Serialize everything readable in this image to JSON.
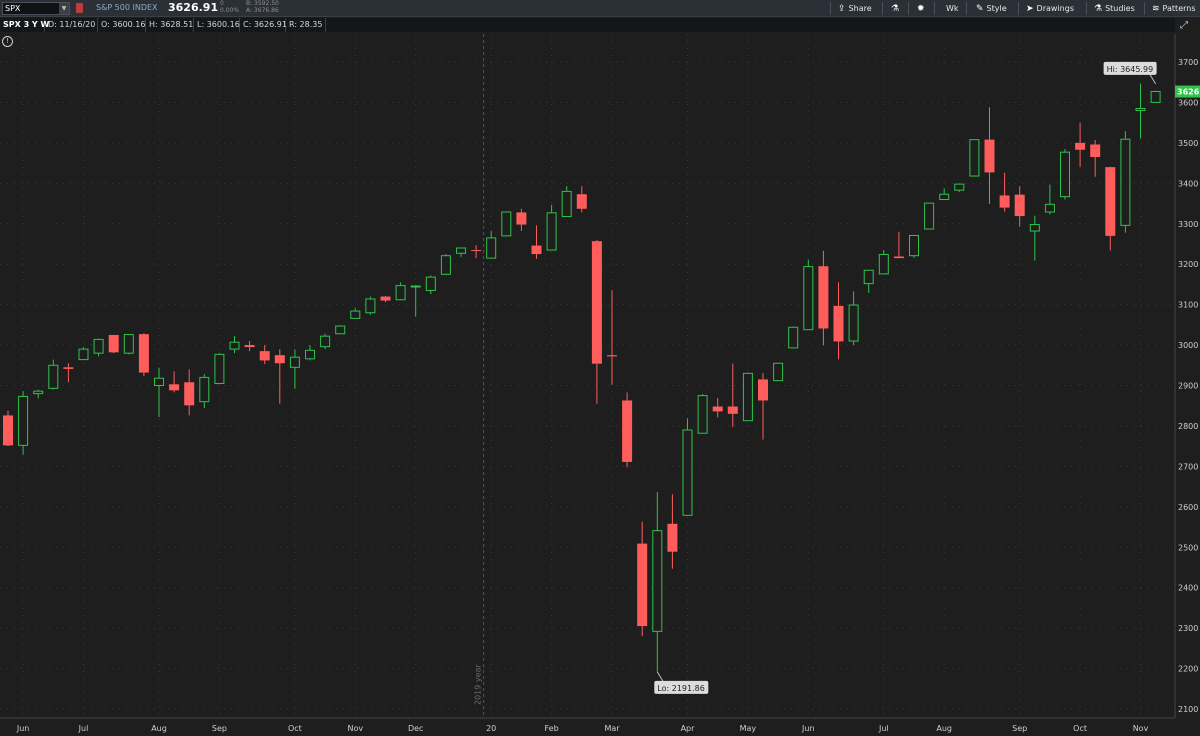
{
  "toolbar": {
    "symbol": "SPX",
    "index_name": "S&P 500 INDEX",
    "last_price": "3626.91",
    "net_change": "0",
    "net_change_pct": "0.00%",
    "bid": "B: 3592.50",
    "ask": "A: 3676.86",
    "share_label": "Share",
    "timeframe_label": "Wk",
    "style_label": "Style",
    "drawings_label": "Drawings",
    "studies_label": "Studies",
    "patterns_label": "Patterns"
  },
  "infobar": {
    "chart_label": "SPX 3 Y W",
    "date": "D: 11/16/20",
    "open": "O: 3600.16",
    "high": "H: 3628.51",
    "low": "L: 3600.16",
    "close": "C: 3626.91",
    "range": "R: 28.35"
  },
  "colors": {
    "background": "#1e1e1e",
    "up": "#2fc34a",
    "down": "#ff5c5c",
    "grid": "#3a3a3a",
    "last_price_badge": "#2fc34a"
  },
  "chart_data": {
    "type": "candlestick",
    "timeframe": "weekly",
    "ylim": [
      2100,
      3720
    ],
    "yticks": [
      2100,
      2200,
      2300,
      2400,
      2500,
      2600,
      2700,
      2800,
      2900,
      3000,
      3100,
      3200,
      3300,
      3400,
      3500,
      3600,
      3700
    ],
    "xtick_labels": [
      "Jun",
      "Jul",
      "Aug",
      "Sep",
      "Oct",
      "Nov",
      "Dec",
      "20",
      "Feb",
      "Mar",
      "Apr",
      "May",
      "Jun",
      "Jul",
      "Aug",
      "Sep",
      "Oct",
      "Nov"
    ],
    "xtick_index": [
      1,
      5,
      10,
      14,
      19,
      23,
      27,
      32,
      36,
      40,
      45,
      49,
      53,
      58,
      62,
      67,
      71,
      75
    ],
    "year_marker": {
      "label": "2019 year",
      "index": 31.5
    },
    "high_annotation": {
      "label": "Hi: 3645.99",
      "value": 3645.99,
      "index": 76
    },
    "low_annotation": {
      "label": "Lo: 2191.86",
      "value": 2191.86,
      "index": 43
    },
    "last_price_label": "3626.",
    "last_price_value": 3626.91,
    "candles": [
      {
        "o": 2826,
        "h": 2838,
        "l": 2750,
        "c": 2752
      },
      {
        "o": 2752,
        "h": 2886,
        "l": 2729,
        "c": 2873
      },
      {
        "o": 2880,
        "h": 2890,
        "l": 2868,
        "c": 2886
      },
      {
        "o": 2893,
        "h": 2964,
        "l": 2890,
        "c": 2950
      },
      {
        "o": 2945,
        "h": 2955,
        "l": 2908,
        "c": 2941
      },
      {
        "o": 2964,
        "h": 2995,
        "l": 2965,
        "c": 2990
      },
      {
        "o": 2980,
        "h": 3016,
        "l": 2972,
        "c": 3014
      },
      {
        "o": 3025,
        "h": 3025,
        "l": 2980,
        "c": 2982
      },
      {
        "o": 2980,
        "h": 3027,
        "l": 2977,
        "c": 3026
      },
      {
        "o": 3027,
        "h": 3029,
        "l": 2923,
        "c": 2932
      },
      {
        "o": 2900,
        "h": 2944,
        "l": 2822,
        "c": 2918
      },
      {
        "o": 2903,
        "h": 2935,
        "l": 2883,
        "c": 2888
      },
      {
        "o": 2908,
        "h": 2940,
        "l": 2826,
        "c": 2851
      },
      {
        "o": 2860,
        "h": 2928,
        "l": 2844,
        "c": 2920
      },
      {
        "o": 2905,
        "h": 2980,
        "l": 2905,
        "c": 2977
      },
      {
        "o": 2990,
        "h": 3022,
        "l": 2980,
        "c": 3007
      },
      {
        "o": 3000,
        "h": 3010,
        "l": 2985,
        "c": 2995
      },
      {
        "o": 2985,
        "h": 3000,
        "l": 2953,
        "c": 2962
      },
      {
        "o": 2975,
        "h": 2990,
        "l": 2855,
        "c": 2955
      },
      {
        "o": 2945,
        "h": 2989,
        "l": 2892,
        "c": 2970
      },
      {
        "o": 2966,
        "h": 3000,
        "l": 2962,
        "c": 2987
      },
      {
        "o": 2996,
        "h": 3028,
        "l": 2990,
        "c": 3022
      },
      {
        "o": 3028,
        "h": 3049,
        "l": 3028,
        "c": 3047
      },
      {
        "o": 3066,
        "h": 3091,
        "l": 3066,
        "c": 3084
      },
      {
        "o": 3080,
        "h": 3120,
        "l": 3075,
        "c": 3114
      },
      {
        "o": 3120,
        "h": 3121,
        "l": 3106,
        "c": 3110
      },
      {
        "o": 3112,
        "h": 3155,
        "l": 3112,
        "c": 3147
      },
      {
        "o": 3145,
        "h": 3148,
        "l": 3070,
        "c": 3146
      },
      {
        "o": 3135,
        "h": 3172,
        "l": 3126,
        "c": 3168
      },
      {
        "o": 3175,
        "h": 3225,
        "l": 3175,
        "c": 3221
      },
      {
        "o": 3227,
        "h": 3241,
        "l": 3218,
        "c": 3240
      },
      {
        "o": 3235,
        "h": 3247,
        "l": 3215,
        "c": 3234
      },
      {
        "o": 3215,
        "h": 3282,
        "l": 3215,
        "c": 3265
      },
      {
        "o": 3270,
        "h": 3330,
        "l": 3270,
        "c": 3329
      },
      {
        "o": 3328,
        "h": 3337,
        "l": 3282,
        "c": 3298
      },
      {
        "o": 3246,
        "h": 3296,
        "l": 3213,
        "c": 3225
      },
      {
        "o": 3235,
        "h": 3347,
        "l": 3235,
        "c": 3327
      },
      {
        "o": 3318,
        "h": 3393,
        "l": 3318,
        "c": 3380
      },
      {
        "o": 3373,
        "h": 3393,
        "l": 3328,
        "c": 3337
      },
      {
        "o": 3257,
        "h": 3260,
        "l": 2855,
        "c": 2954
      },
      {
        "o": 2975,
        "h": 3136,
        "l": 2902,
        "c": 2972
      },
      {
        "o": 2863,
        "h": 2883,
        "l": 2698,
        "c": 2711
      },
      {
        "o": 2509,
        "h": 2563,
        "l": 2280,
        "c": 2305
      },
      {
        "o": 2292,
        "h": 2637,
        "l": 2192,
        "c": 2541
      },
      {
        "o": 2558,
        "h": 2631,
        "l": 2447,
        "c": 2489
      },
      {
        "o": 2579,
        "h": 2819,
        "l": 2579,
        "c": 2790
      },
      {
        "o": 2782,
        "h": 2879,
        "l": 2782,
        "c": 2875
      },
      {
        "o": 2848,
        "h": 2869,
        "l": 2821,
        "c": 2836
      },
      {
        "o": 2848,
        "h": 2954,
        "l": 2797,
        "c": 2830
      },
      {
        "o": 2813,
        "h": 2932,
        "l": 2813,
        "c": 2930
      },
      {
        "o": 2915,
        "h": 2931,
        "l": 2766,
        "c": 2863
      },
      {
        "o": 2912,
        "h": 2956,
        "l": 2913,
        "c": 2955
      },
      {
        "o": 2993,
        "h": 3046,
        "l": 2993,
        "c": 3044
      },
      {
        "o": 3038,
        "h": 3211,
        "l": 3038,
        "c": 3194
      },
      {
        "o": 3195,
        "h": 3233,
        "l": 2999,
        "c": 3041
      },
      {
        "o": 3097,
        "h": 3155,
        "l": 2965,
        "c": 3009
      },
      {
        "o": 3010,
        "h": 3133,
        "l": 3000,
        "c": 3099
      },
      {
        "o": 3152,
        "h": 3186,
        "l": 3129,
        "c": 3185
      },
      {
        "o": 3176,
        "h": 3235,
        "l": 3176,
        "c": 3224
      },
      {
        "o": 3219,
        "h": 3280,
        "l": 3216,
        "c": 3215
      },
      {
        "o": 3221,
        "h": 3271,
        "l": 3216,
        "c": 3271
      },
      {
        "o": 3287,
        "h": 3351,
        "l": 3288,
        "c": 3351
      },
      {
        "o": 3360,
        "h": 3387,
        "l": 3360,
        "c": 3373
      },
      {
        "o": 3383,
        "h": 3396,
        "l": 3379,
        "c": 3398
      },
      {
        "o": 3418,
        "h": 3507,
        "l": 3418,
        "c": 3508
      },
      {
        "o": 3508,
        "h": 3588,
        "l": 3349,
        "c": 3427
      },
      {
        "o": 3370,
        "h": 3426,
        "l": 3330,
        "c": 3340
      },
      {
        "o": 3372,
        "h": 3393,
        "l": 3293,
        "c": 3319
      },
      {
        "o": 3282,
        "h": 3320,
        "l": 3209,
        "c": 3298
      },
      {
        "o": 3329,
        "h": 3397,
        "l": 3323,
        "c": 3348
      },
      {
        "o": 3367,
        "h": 3485,
        "l": 3360,
        "c": 3477
      },
      {
        "o": 3500,
        "h": 3550,
        "l": 3441,
        "c": 3483
      },
      {
        "o": 3496,
        "h": 3507,
        "l": 3416,
        "c": 3465
      },
      {
        "o": 3440,
        "h": 3441,
        "l": 3234,
        "c": 3270
      },
      {
        "o": 3296,
        "h": 3529,
        "l": 3278,
        "c": 3509
      },
      {
        "o": 3580,
        "h": 3646,
        "l": 3511,
        "c": 3585
      },
      {
        "o": 3600,
        "h": 3629,
        "l": 3600,
        "c": 3627
      }
    ]
  }
}
